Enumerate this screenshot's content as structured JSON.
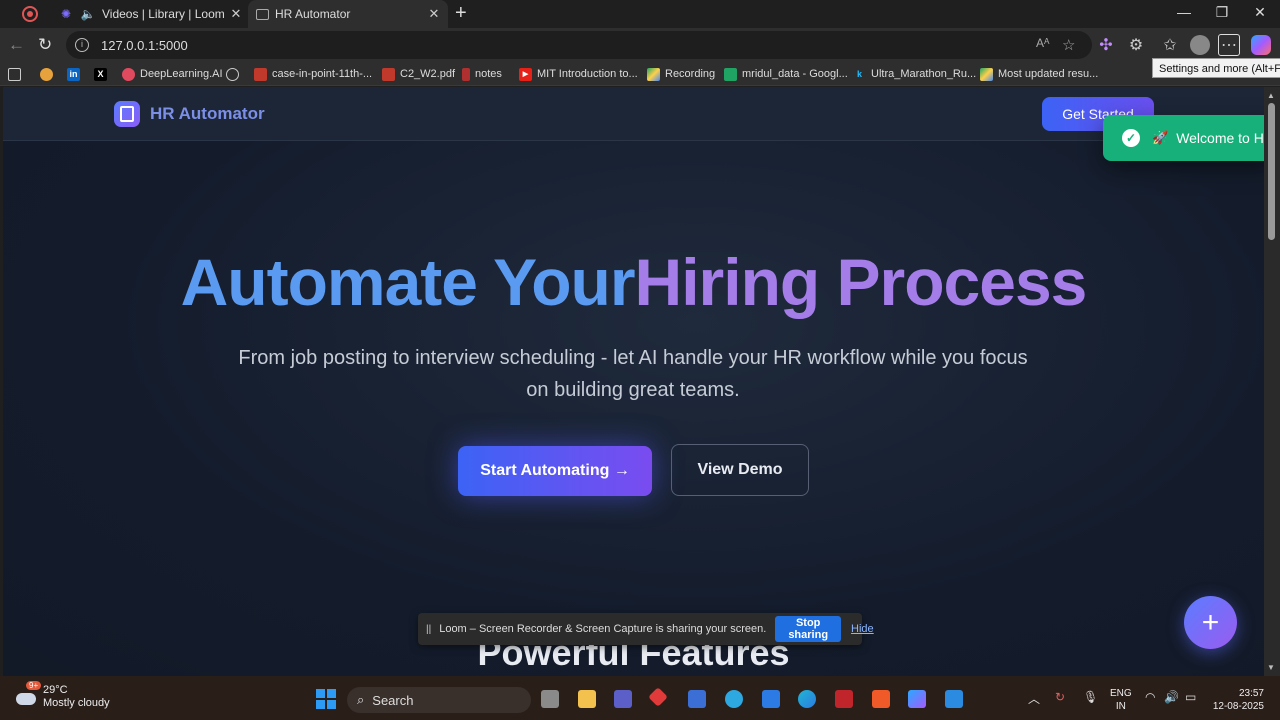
{
  "browser": {
    "tabs": [
      {
        "label": "Videos | Library | Loom",
        "active": false
      },
      {
        "label": "HR Automator",
        "active": true
      }
    ],
    "url": "127.0.0.1:5000",
    "tooltip": "Settings and more (Alt+F)",
    "bookmarks": [
      {
        "label": "",
        "icon": "emoji-icon"
      },
      {
        "label": "",
        "icon": "linkedin-icon"
      },
      {
        "label": "",
        "icon": "x-icon"
      },
      {
        "label": "DeepLearning.AI",
        "icon": "deeplearning-icon"
      },
      {
        "label": "",
        "icon": "globe-icon"
      },
      {
        "label": "case-in-point-11th-...",
        "icon": "pdf-icon"
      },
      {
        "label": "C2_W2.pdf",
        "icon": "pdf-icon"
      },
      {
        "label": "notes",
        "icon": "notes-icon"
      },
      {
        "label": "MIT Introduction to...",
        "icon": "youtube-icon"
      },
      {
        "label": "Recording",
        "icon": "drive-icon"
      },
      {
        "label": "mridul_data - Googl...",
        "icon": "sheets-icon"
      },
      {
        "label": "Ultra_Marathon_Ru...",
        "icon": "kaggle-icon"
      },
      {
        "label": "Most updated resu...",
        "icon": "drive-icon"
      }
    ]
  },
  "site": {
    "brand": "HR Automator",
    "nav_cta": "Get Started",
    "toast": "Welcome to HR",
    "hero": {
      "title_a": "Automate Your",
      "title_b": "Hiring Process",
      "subtitle": "From job posting to interview scheduling - let AI handle your HR workflow while you focus on building great teams.",
      "primary_cta": "Start Automating →",
      "secondary_cta": "View Demo"
    },
    "features_heading": "Powerful Features",
    "fab": "+"
  },
  "loom": {
    "message": "Loom – Screen Recorder & Screen Capture is sharing your screen.",
    "stop": "Stop sharing",
    "hide": "Hide"
  },
  "taskbar": {
    "weather_temp": "29°C",
    "weather_desc": "Mostly cloudy",
    "weather_badge": "9+",
    "search": "Search",
    "lang_1": "ENG",
    "lang_2": "IN",
    "time": "23:57",
    "date": "12-08-2025"
  },
  "colors": {
    "accent_blue": "#3c63f5",
    "accent_purple": "#7a4cf0",
    "toast_green": "#18b07a",
    "title_blue": "#5a9af0",
    "title_purple": "#a47de8"
  }
}
